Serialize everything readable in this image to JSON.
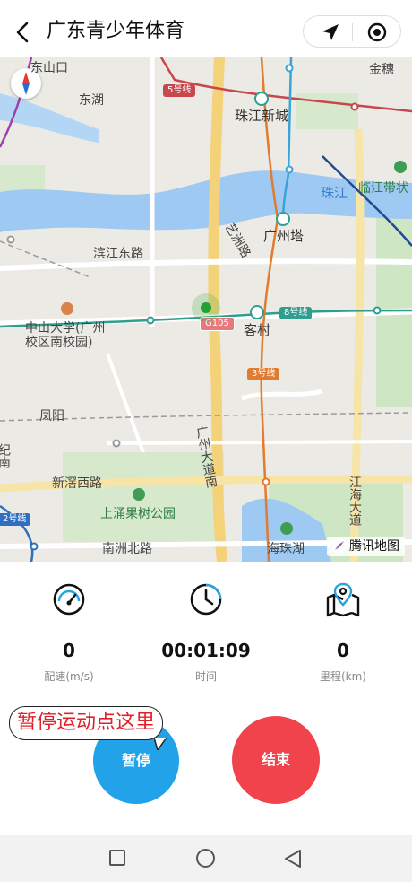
{
  "header": {
    "title": "广东青少年体育",
    "back_icon": "chevron-left-icon",
    "capsule": {
      "left_icon": "navigation-arrow-icon",
      "right_icon": "record-target-icon"
    }
  },
  "map": {
    "labels": {
      "dongshankou": "东山口",
      "donghu": "东湖",
      "jinhui": "金穗",
      "zhujiangxincheng": "珠江新城",
      "zhujiang": "珠江",
      "linjiang": "临江带状",
      "guangzhouta": "广州塔",
      "yizhoulu": "艺洲路",
      "binjiangdonglu": "滨江东路",
      "zhongshan": "中山大学(广州\n校区南校园)",
      "kecun": "客村",
      "fengyang": "凤阳",
      "guangzhoudadaonan": "广州大道南",
      "xinjiaoxilu": "新滘西路",
      "shangchong": "上涌果树公园",
      "nanzhoubeilu": "南洲北路",
      "haizhuhu": "海珠湖",
      "jianghaidadao": "江海大道",
      "left_edge": "纪南"
    },
    "tags": {
      "line5": "5号线",
      "line8": "8号线",
      "line3": "3号线",
      "line2": "2号线",
      "g105": "G105"
    },
    "compass_icon": "compass-icon",
    "provider": "腾讯地图",
    "provider_icon": "tencent-map-logo-icon",
    "location_icon": "current-location-dot-icon"
  },
  "stats": [
    {
      "value": "0",
      "label": "配速(m/s)",
      "icon": "speedometer-icon"
    },
    {
      "value": "00:01:09",
      "label": "时间",
      "icon": "clock-icon"
    },
    {
      "value": "0",
      "label": "里程(km)",
      "icon": "map-pin-route-icon"
    }
  ],
  "actions": {
    "pause": "暂停",
    "end": "结束",
    "hint": "暂停运动点这里"
  },
  "sysnav": {
    "recent_icon": "square-icon",
    "home_icon": "circle-icon",
    "back_icon": "triangle-back-icon"
  },
  "colors": {
    "pause": "#22a2e8",
    "end": "#f0434b",
    "hint_text": "#e0202a"
  }
}
